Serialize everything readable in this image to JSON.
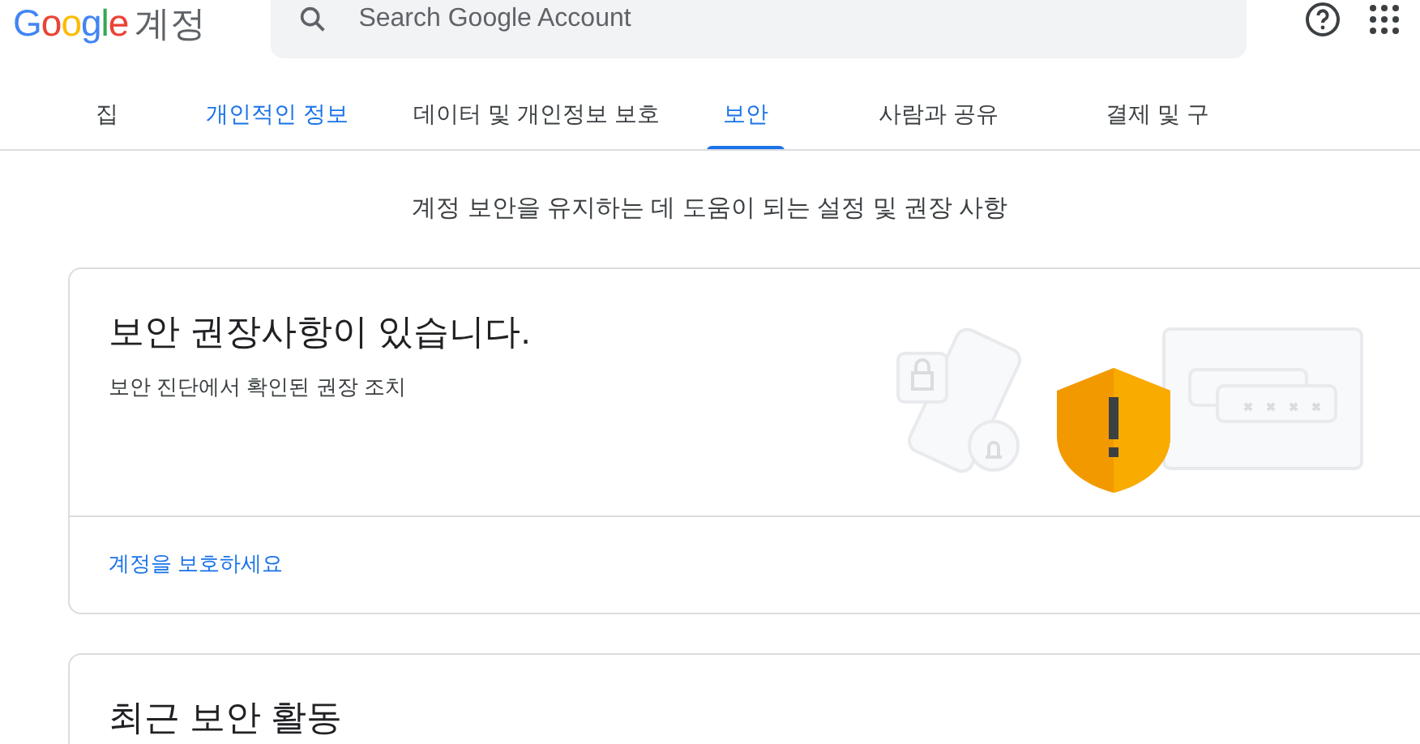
{
  "header": {
    "logo": "Google",
    "product": "계정",
    "search": {
      "placeholder": "Search Google Account"
    }
  },
  "tabs": [
    {
      "label": "집",
      "selected": false,
      "hovered": false
    },
    {
      "label": "개인적인 정보",
      "selected": false,
      "hovered": true
    },
    {
      "label": "데이터 및 개인정보 보호",
      "selected": false,
      "hovered": false
    },
    {
      "label": "보안",
      "selected": true,
      "hovered": false
    },
    {
      "label": "사람과 공유",
      "selected": false,
      "hovered": false
    },
    {
      "label": "결제 및 구",
      "selected": false,
      "hovered": false
    }
  ],
  "subtitle": "계정 보안을 유지하는 데 도움이 되는 설정 및 권장 사항",
  "recommendation_card": {
    "title": "보안 권장사항이 있습니다.",
    "description": "보안 진단에서 확인된 권장 조치",
    "link": "계정을 보호하세요"
  },
  "activity_card": {
    "title": "최근 보안 활동"
  }
}
